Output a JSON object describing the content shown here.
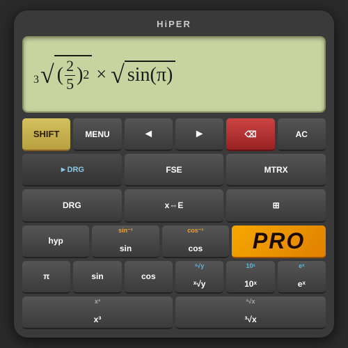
{
  "app": {
    "brand": "HiPER",
    "pro_label": "PRO"
  },
  "display": {
    "formula": "³√(2/5)² × √sin(π)"
  },
  "buttons": {
    "row1": [
      {
        "id": "shift",
        "label": "SHIFT",
        "type": "shift"
      },
      {
        "id": "menu",
        "label": "MENU",
        "type": "menu"
      },
      {
        "id": "left",
        "label": "◄",
        "type": "arrow"
      },
      {
        "id": "right",
        "label": "►",
        "type": "arrow"
      },
      {
        "id": "backspace",
        "label": "⌫",
        "type": "backspace"
      },
      {
        "id": "ac",
        "label": "AC",
        "type": "ac"
      }
    ],
    "row2": [
      {
        "id": "drg-mode",
        "label": "►DRG",
        "type": "drg"
      },
      {
        "id": "fse",
        "label": "FSE",
        "type": "dark"
      },
      {
        "id": "mtrx",
        "label": "MTRX",
        "type": "dark"
      }
    ],
    "row3": [
      {
        "id": "drg",
        "label": "DRG",
        "sub": "",
        "type": "dark"
      },
      {
        "id": "xe",
        "label": "x⇔E",
        "sub": "",
        "type": "dark"
      },
      {
        "id": "disp",
        "label": "⊞",
        "sub": "",
        "type": "dark"
      }
    ],
    "row4": [
      {
        "id": "hyp",
        "label": "hyp",
        "sub": "",
        "type": "dark"
      },
      {
        "id": "sin-inv",
        "label": "sin",
        "sub": "sin⁻¹",
        "type": "dark"
      },
      {
        "id": "cos-inv",
        "label": "cos",
        "sub": "cos⁻¹",
        "type": "dark"
      }
    ],
    "row5": [
      {
        "id": "pi",
        "label": "π",
        "sub": "",
        "type": "dark"
      },
      {
        "id": "sin",
        "label": "sin",
        "sub": "",
        "type": "dark"
      },
      {
        "id": "cos",
        "label": "cos",
        "sub": "",
        "type": "dark"
      },
      {
        "id": "xrty",
        "label": "ˣ√y",
        "sub": "",
        "type": "dark"
      },
      {
        "id": "ten-x",
        "label": "10ˣ",
        "sub": "",
        "type": "dark"
      },
      {
        "id": "ex",
        "label": "eˣ",
        "sub": "",
        "type": "dark"
      }
    ],
    "row6": [
      {
        "id": "xcubed",
        "label": "x³",
        "sub": "",
        "type": "dark"
      },
      {
        "id": "cbrt",
        "label": "³√x",
        "sub": "",
        "type": "dark"
      },
      {
        "id": "pro",
        "label": "PRO",
        "type": "pro"
      }
    ]
  }
}
